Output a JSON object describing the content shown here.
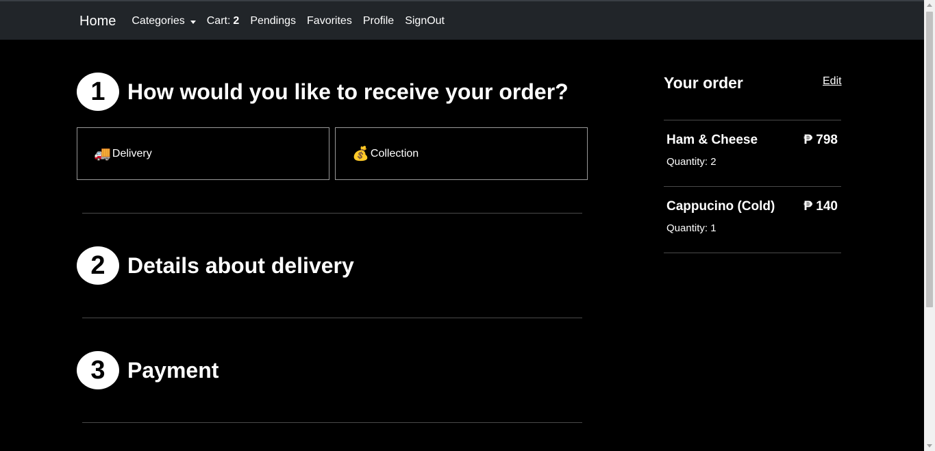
{
  "nav": {
    "brand": "Home",
    "categories": "Categories",
    "cart_label": "Cart:",
    "cart_count": "2",
    "pendings": "Pendings",
    "favorites": "Favorites",
    "profile": "Profile",
    "signout": "SignOut"
  },
  "steps": [
    {
      "number": "1",
      "title": "How would you like to receive your order?"
    },
    {
      "number": "2",
      "title": "Details about delivery"
    },
    {
      "number": "3",
      "title": "Payment"
    }
  ],
  "options": [
    {
      "icon": "delivery-truck-icon",
      "glyph": "🚚",
      "label": "Delivery"
    },
    {
      "icon": "hand-money-bag-icon",
      "glyph": "💰",
      "label": "Collection"
    }
  ],
  "order": {
    "title": "Your order",
    "edit": "Edit",
    "items": [
      {
        "name": "Ham & Cheese",
        "price": "₱ 798",
        "quantity": "Quantity: 2"
      },
      {
        "name": "Cappucino (Cold)",
        "price": "₱ 140",
        "quantity": "Quantity: 1"
      }
    ]
  }
}
